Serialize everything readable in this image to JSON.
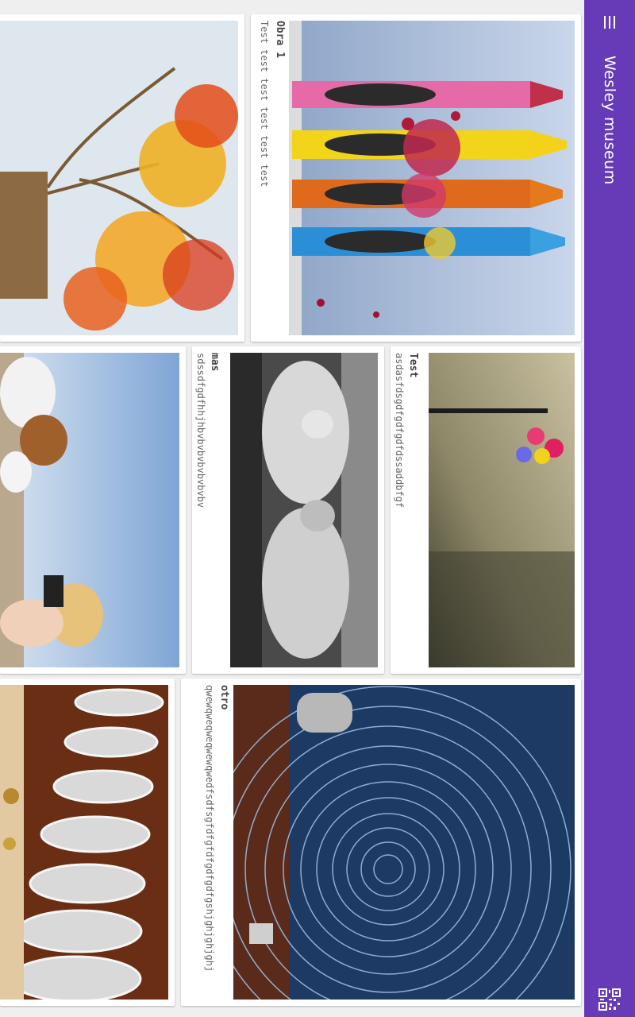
{
  "app": {
    "title": "Wesley museum",
    "menu_icon": "hamburger-menu-icon",
    "qr_icon": "qr-code-icon",
    "accent": "#673ab7"
  },
  "cards": [
    {
      "title": "Obra 1",
      "description": "Test test test test test test",
      "image": "exploding-crayons"
    },
    {
      "title": "Test",
      "description": "asdasfdsgdfgdfgdfdssaddbfgf",
      "image": "balloons-on-beach"
    },
    {
      "title": "mas",
      "description": "sdssdfgdfhhjhbvbvbvbvbvbvbv",
      "image": "black-white-baby-pillows"
    },
    {
      "title": "otro",
      "description": "qwewqweqweqwewqwedfsdfsgfdfgfdfgdfgdfgshjghjghjghj",
      "image": "star-trails-observatory"
    },
    {
      "title": "",
      "description": "",
      "image": "autumn-tree"
    },
    {
      "title": "",
      "description": "",
      "image": "photographers-beach"
    },
    {
      "title": "",
      "description": "",
      "image": "buffet-trays"
    }
  ]
}
